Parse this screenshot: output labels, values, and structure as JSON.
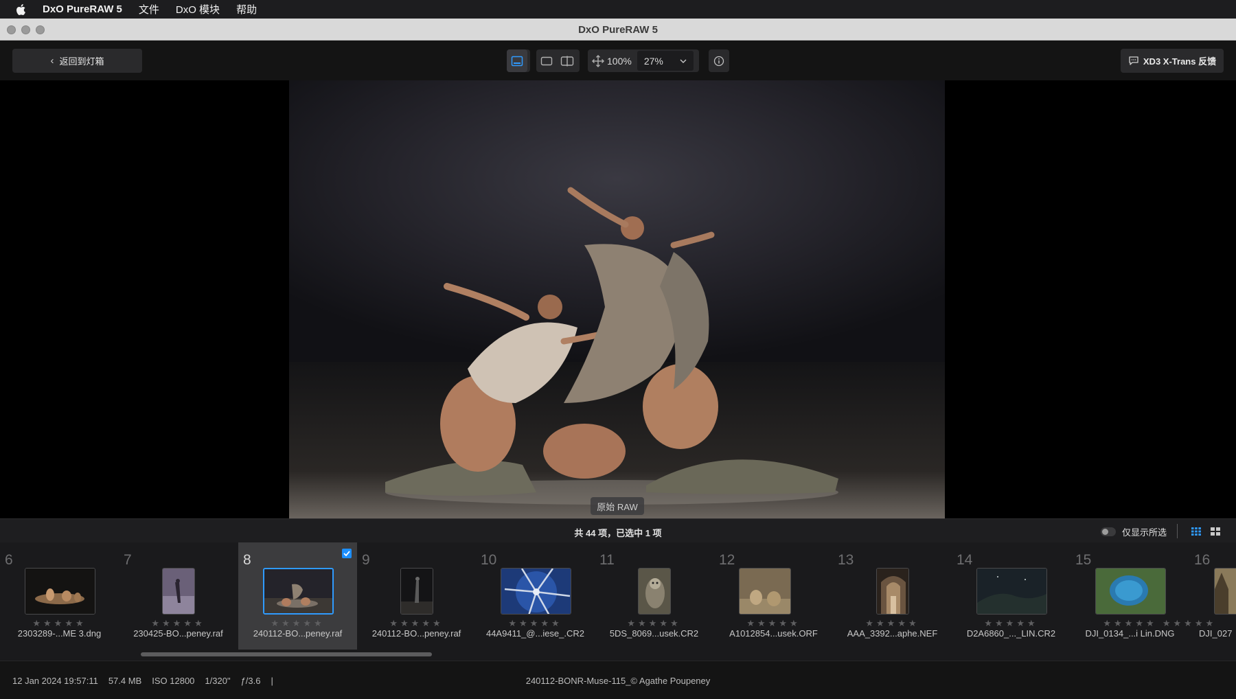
{
  "menubar": {
    "app_name": "DxO PureRAW 5",
    "items": [
      "文件",
      "DxO 模块",
      "帮助"
    ]
  },
  "window": {
    "title": "DxO PureRAW 5"
  },
  "toolbar": {
    "back_label": "返回到灯箱",
    "zoom_100": "100%",
    "zoom_value": "27%",
    "feedback_label": "XD3 X-Trans 反馈"
  },
  "viewer": {
    "overlay_label": "原始 RAW"
  },
  "filmstrip": {
    "summary": "共 44 项，已选中 1 项",
    "only_selected_label": "仅显示所选",
    "items": [
      {
        "number": "6",
        "filename": "2303289-...ME 3.dng",
        "stars": "★★★★★",
        "selected": false
      },
      {
        "number": "7",
        "filename": "230425-BO...peney.raf",
        "stars": "★★★★★",
        "selected": false
      },
      {
        "number": "8",
        "filename": "240112-BO...peney.raf",
        "stars": "★★★★★",
        "selected": true
      },
      {
        "number": "9",
        "filename": "240112-BO...peney.raf",
        "stars": "★★★★★",
        "selected": false
      },
      {
        "number": "10",
        "filename": "44A9411_@...iese_.CR2",
        "stars": "★★★★★",
        "selected": false
      },
      {
        "number": "11",
        "filename": "5DS_8069...usek.CR2",
        "stars": "★★★★★",
        "selected": false
      },
      {
        "number": "12",
        "filename": "A1012854...usek.ORF",
        "stars": "★★★★★",
        "selected": false
      },
      {
        "number": "13",
        "filename": "AAA_3392...aphe.NEF",
        "stars": "★★★★★",
        "selected": false
      },
      {
        "number": "14",
        "filename": "D2A6860_..._LIN.CR2",
        "stars": "★★★★★",
        "selected": false
      },
      {
        "number": "15",
        "filename": "DJI_0134_...i Lin.DNG",
        "stars": "★★★★★",
        "selected": false
      },
      {
        "number": "16",
        "filename": "DJI_027",
        "stars": "★★★★★",
        "selected": false
      }
    ]
  },
  "status": {
    "date": "12 Jan 2024 19:57:11",
    "size": "57.4 MB",
    "iso": "ISO 12800",
    "shutter": "1/320\"",
    "aperture": "ƒ/3.6",
    "separator": "|",
    "filename": "240112-BONR-Muse-115_© Agathe Poupeney"
  },
  "colors": {
    "accent": "#2f9bff",
    "selected_cell": "#3c3c3e"
  }
}
